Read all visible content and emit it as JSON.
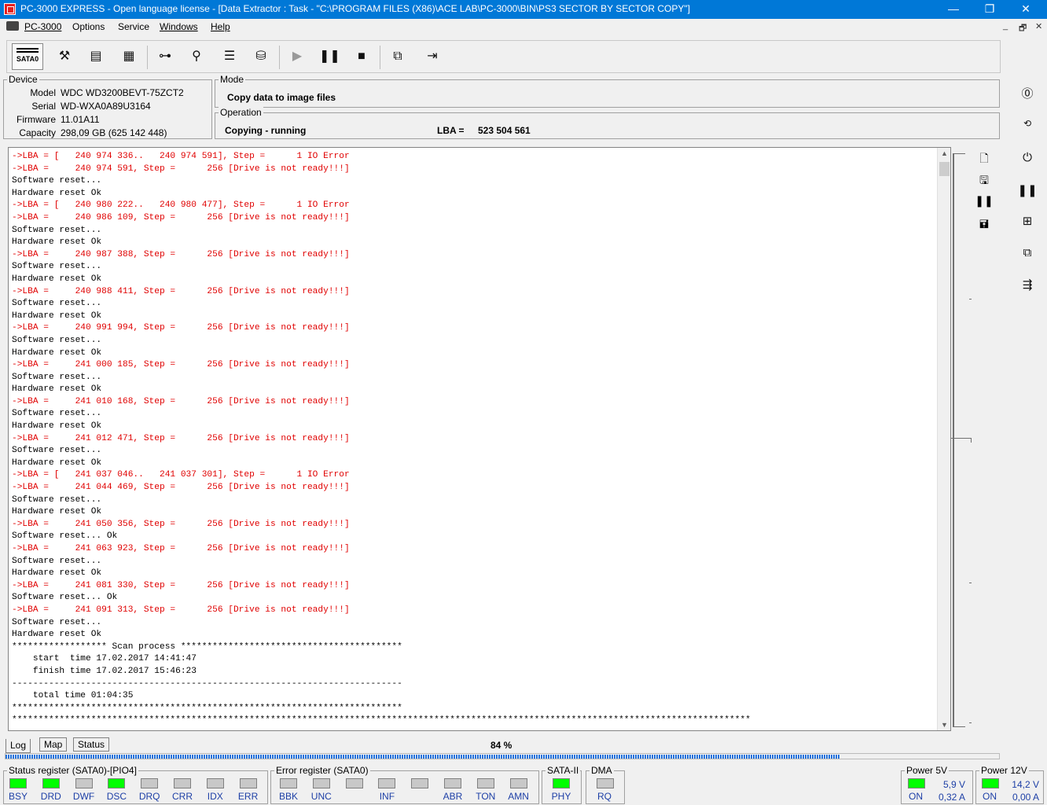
{
  "window": {
    "title": "PC-3000 EXPRESS - Open language license - [Data Extractor : Task - \"C:\\PROGRAM FILES (X86)\\ACE LAB\\PC-3000\\BIN\\PS3 SECTOR BY SECTOR COPY\"]",
    "controls": [
      "—",
      "❐",
      "✕"
    ]
  },
  "menu": {
    "items": [
      "PC-3000",
      "Options",
      "Service",
      "Windows",
      "Help"
    ],
    "mdi_controls": [
      "_",
      "🗗",
      "✕"
    ]
  },
  "toolbar": {
    "port_label": "SATA0"
  },
  "device": {
    "group_title": "Device",
    "model_label": "Model",
    "model": "WDC WD3200BEVT-75ZCT2",
    "serial_label": "Serial",
    "serial": "WD-WXA0A89U3164",
    "firmware_label": "Firmware",
    "firmware": "11.01A11",
    "capacity_label": "Capacity",
    "capacity": "298,09 GB (625 142 448)"
  },
  "mode": {
    "group_title": "Mode",
    "value": "Copy data to image files"
  },
  "operation": {
    "group_title": "Operation",
    "value": "Copying - running",
    "lba_label": "LBA =",
    "lba": "523 504 561"
  },
  "log": {
    "lines": [
      {
        "t": "->LBA = [   240 974 336..   240 974 591], Step =      1 IO Error",
        "c": "red"
      },
      {
        "t": "->LBA =     240 974 591, Step =      256 [Drive is not ready!!!]",
        "c": "red"
      },
      {
        "t": "Software reset...",
        "c": "blk"
      },
      {
        "t": "Hardware reset Ok",
        "c": "blk"
      },
      {
        "t": "->LBA = [   240 980 222..   240 980 477], Step =      1 IO Error",
        "c": "red"
      },
      {
        "t": "->LBA =     240 986 109, Step =      256 [Drive is not ready!!!]",
        "c": "red"
      },
      {
        "t": "Software reset...",
        "c": "blk"
      },
      {
        "t": "Hardware reset Ok",
        "c": "blk"
      },
      {
        "t": "->LBA =     240 987 388, Step =      256 [Drive is not ready!!!]",
        "c": "red"
      },
      {
        "t": "Software reset...",
        "c": "blk"
      },
      {
        "t": "Hardware reset Ok",
        "c": "blk"
      },
      {
        "t": "->LBA =     240 988 411, Step =      256 [Drive is not ready!!!]",
        "c": "red"
      },
      {
        "t": "Software reset...",
        "c": "blk"
      },
      {
        "t": "Hardware reset Ok",
        "c": "blk"
      },
      {
        "t": "->LBA =     240 991 994, Step =      256 [Drive is not ready!!!]",
        "c": "red"
      },
      {
        "t": "Software reset...",
        "c": "blk"
      },
      {
        "t": "Hardware reset Ok",
        "c": "blk"
      },
      {
        "t": "->LBA =     241 000 185, Step =      256 [Drive is not ready!!!]",
        "c": "red"
      },
      {
        "t": "Software reset...",
        "c": "blk"
      },
      {
        "t": "Hardware reset Ok",
        "c": "blk"
      },
      {
        "t": "->LBA =     241 010 168, Step =      256 [Drive is not ready!!!]",
        "c": "red"
      },
      {
        "t": "Software reset...",
        "c": "blk"
      },
      {
        "t": "Hardware reset Ok",
        "c": "blk"
      },
      {
        "t": "->LBA =     241 012 471, Step =      256 [Drive is not ready!!!]",
        "c": "red"
      },
      {
        "t": "Software reset...",
        "c": "blk"
      },
      {
        "t": "Hardware reset Ok",
        "c": "blk"
      },
      {
        "t": "->LBA = [   241 037 046..   241 037 301], Step =      1 IO Error",
        "c": "red"
      },
      {
        "t": "->LBA =     241 044 469, Step =      256 [Drive is not ready!!!]",
        "c": "red"
      },
      {
        "t": "Software reset...",
        "c": "blk"
      },
      {
        "t": "Hardware reset Ok",
        "c": "blk"
      },
      {
        "t": "->LBA =     241 050 356, Step =      256 [Drive is not ready!!!]",
        "c": "red"
      },
      {
        "t": "Software reset... Ok",
        "c": "blk"
      },
      {
        "t": "->LBA =     241 063 923, Step =      256 [Drive is not ready!!!]",
        "c": "red"
      },
      {
        "t": "Software reset...",
        "c": "blk"
      },
      {
        "t": "Hardware reset Ok",
        "c": "blk"
      },
      {
        "t": "->LBA =     241 081 330, Step =      256 [Drive is not ready!!!]",
        "c": "red"
      },
      {
        "t": "Software reset... Ok",
        "c": "blk"
      },
      {
        "t": "->LBA =     241 091 313, Step =      256 [Drive is not ready!!!]",
        "c": "red"
      },
      {
        "t": "Software reset...",
        "c": "blk"
      },
      {
        "t": "Hardware reset Ok",
        "c": "blk"
      },
      {
        "t": "****************** Scan process ******************************************",
        "c": "blk"
      },
      {
        "t": "    start  time 17.02.2017 14:41:47",
        "c": "blk"
      },
      {
        "t": "    finish time 17.02.2017 15:46:23",
        "c": "blk"
      },
      {
        "t": "--------------------------------------------------------------------------",
        "c": "blk"
      },
      {
        "t": "    total time 01:04:35",
        "c": "blk"
      },
      {
        "t": "**************************************************************************",
        "c": "blk"
      },
      {
        "t": "********************************************************************************************************************************************",
        "c": "blk"
      }
    ]
  },
  "tabs": [
    "Log",
    "Map",
    "Status"
  ],
  "progress": {
    "label": "84 %",
    "fraction": 0.84
  },
  "status_register": {
    "title": "Status register (SATA0)-[PIO4]",
    "bits": [
      {
        "name": "BSY",
        "on": true
      },
      {
        "name": "DRD",
        "on": true
      },
      {
        "name": "DWF",
        "on": false
      },
      {
        "name": "DSC",
        "on": true
      },
      {
        "name": "DRQ",
        "on": false
      },
      {
        "name": "CRR",
        "on": false
      },
      {
        "name": "IDX",
        "on": false
      },
      {
        "name": "ERR",
        "on": false
      }
    ]
  },
  "error_register": {
    "title": "Error register (SATA0)",
    "bits": [
      {
        "name": "BBK",
        "on": false
      },
      {
        "name": "UNC",
        "on": false
      },
      {
        "name": "",
        "on": false
      },
      {
        "name": "INF",
        "on": false
      },
      {
        "name": "",
        "on": false
      },
      {
        "name": "ABR",
        "on": false
      },
      {
        "name": "TON",
        "on": false
      },
      {
        "name": "AMN",
        "on": false
      }
    ]
  },
  "sata2": {
    "title": "SATA-II",
    "bit": {
      "name": "PHY",
      "on": true
    }
  },
  "dma": {
    "title": "DMA",
    "bit": {
      "name": "RQ",
      "on": false
    }
  },
  "power5": {
    "title": "Power 5V",
    "state": "ON",
    "voltage": "5,9 V",
    "current": "0,32 A"
  },
  "power12": {
    "title": "Power 12V",
    "state": "ON",
    "voltage": "14,2 V",
    "current": "0,00 A"
  },
  "colors": {
    "titlebar": "#0078d7",
    "log_error": "#e00000",
    "led_on": "#00ff00",
    "led_off": "#c8c8c8"
  }
}
